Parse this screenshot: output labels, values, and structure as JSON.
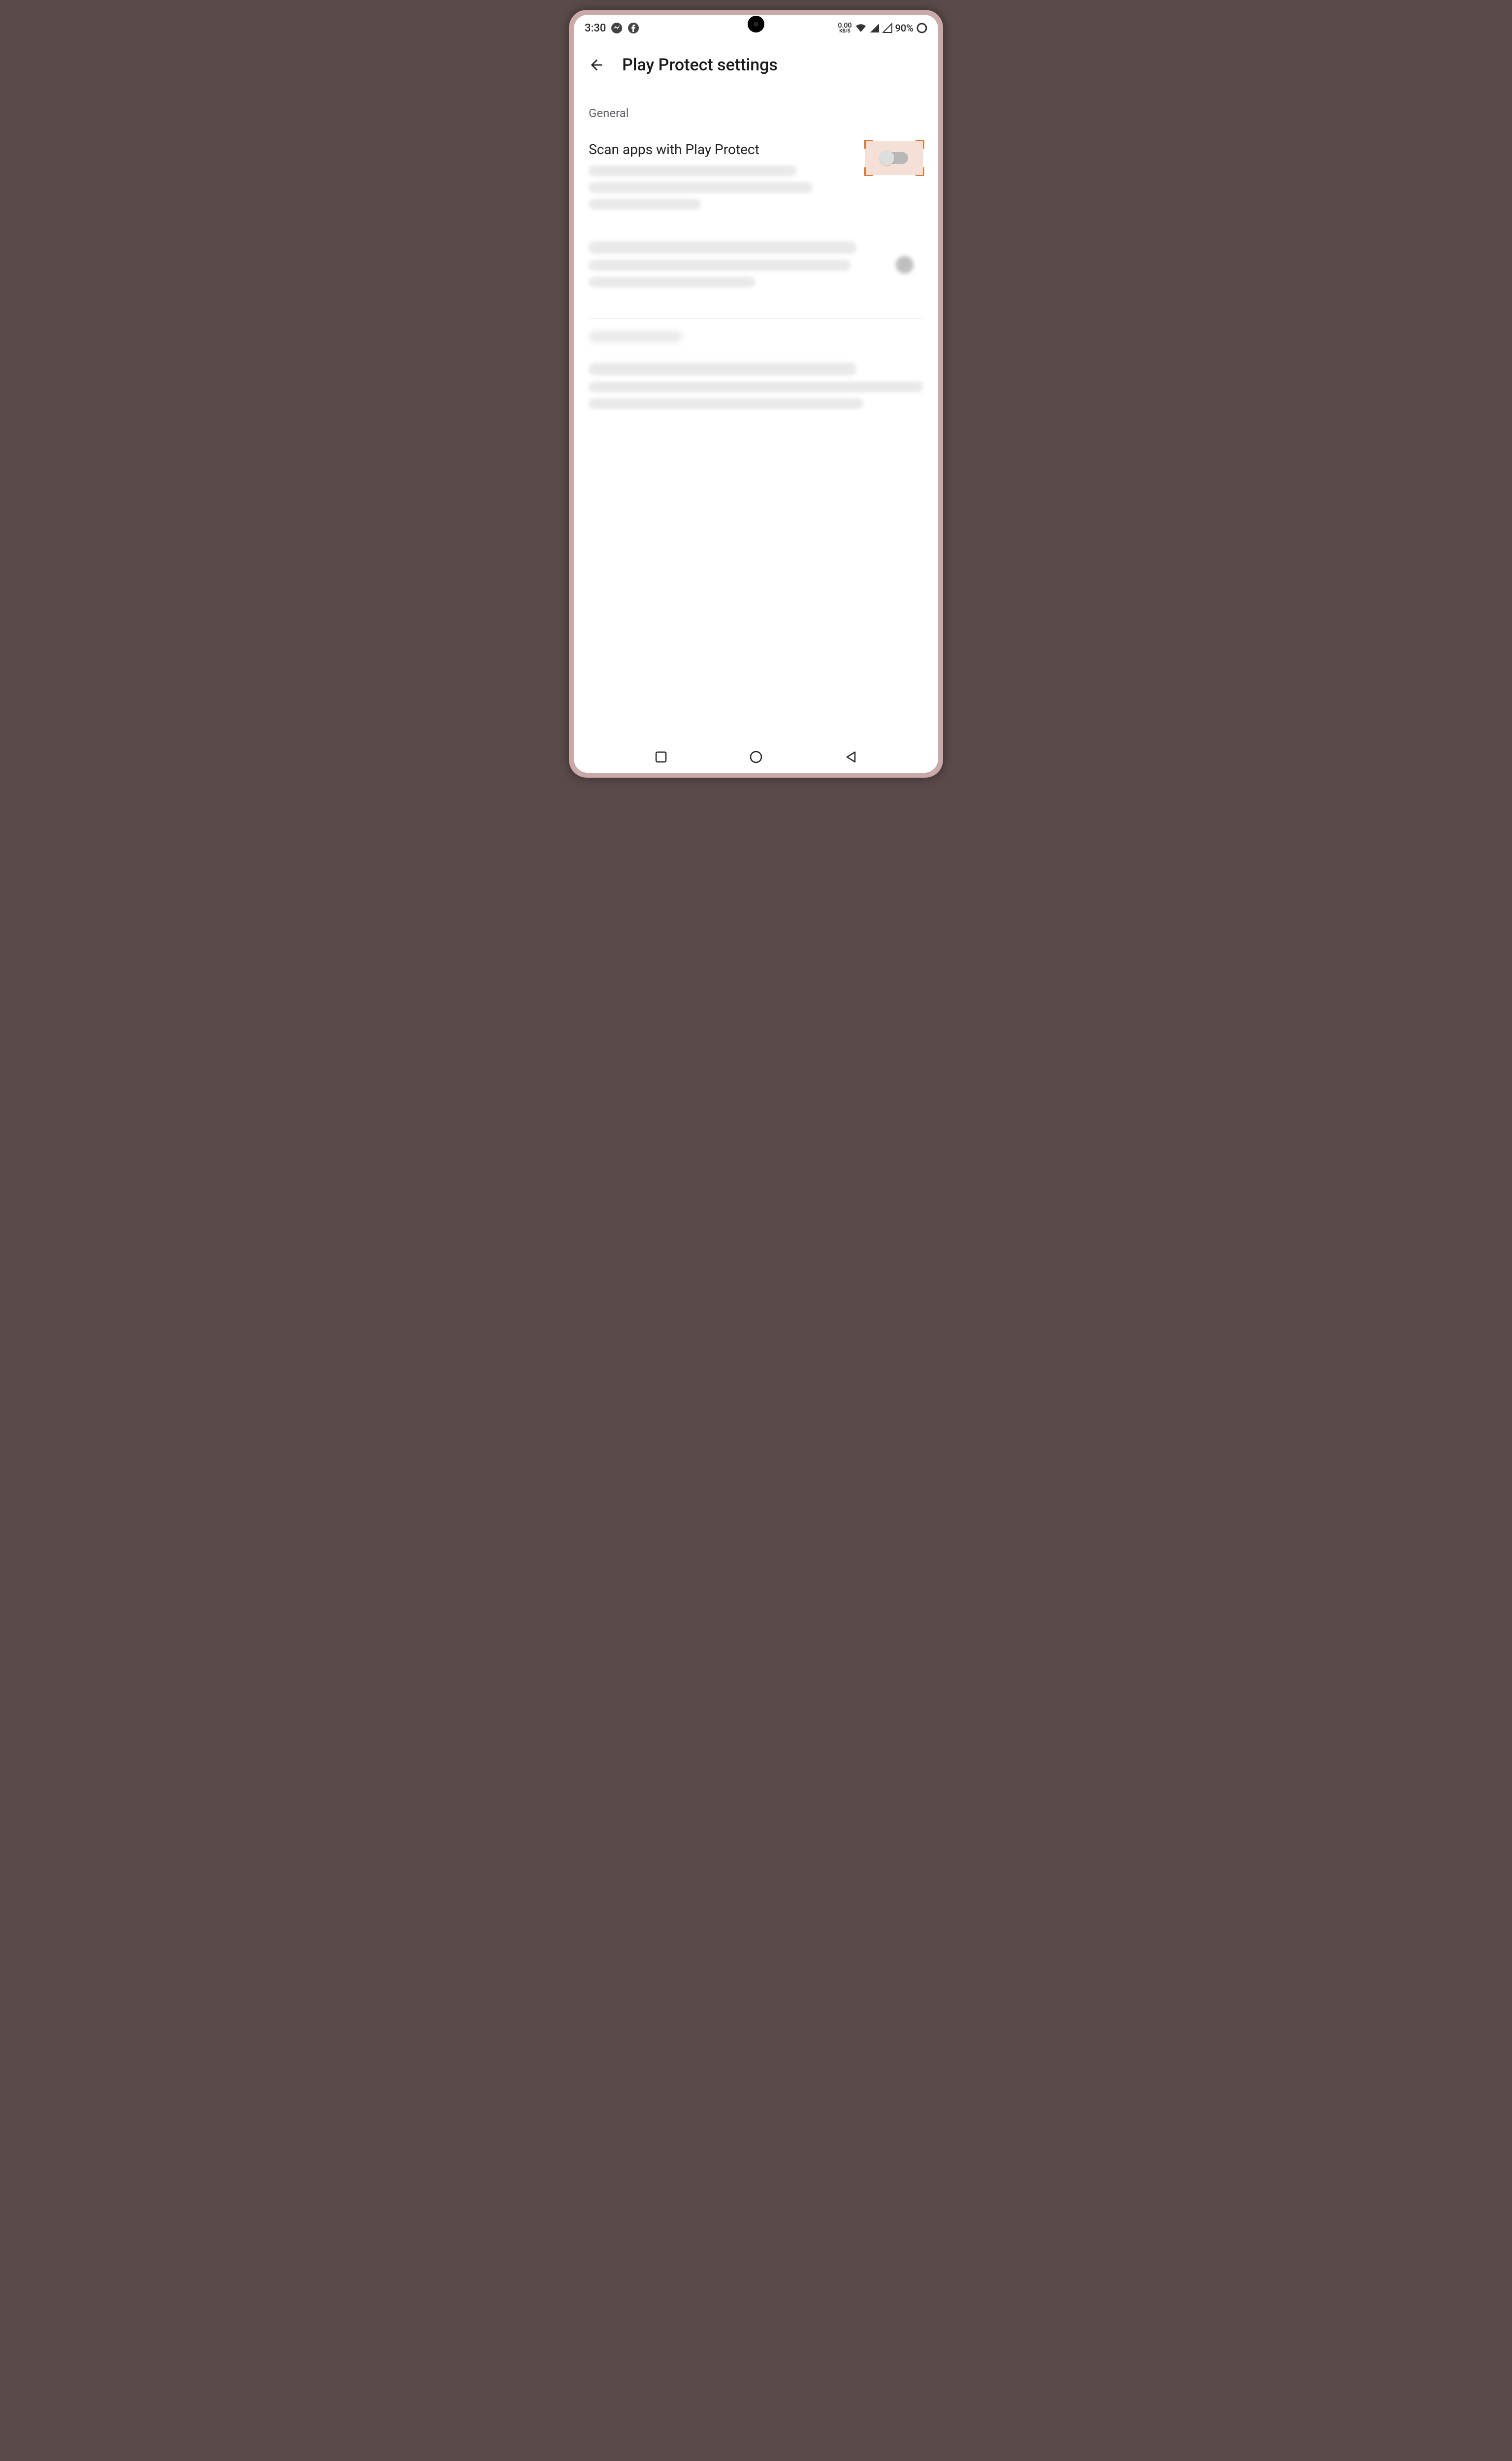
{
  "status": {
    "time": "3:30",
    "data_rate_value": "0.00",
    "data_rate_unit": "KB/S",
    "battery_pct": "90%",
    "icons_left": [
      "messenger",
      "facebook"
    ],
    "icons_right": [
      "wifi",
      "signal1",
      "signal2",
      "data-saver"
    ]
  },
  "header": {
    "title": "Play Protect settings"
  },
  "sections": {
    "general_label": "General",
    "scan_apps": {
      "title": "Scan apps with Play Protect",
      "toggle_state": "off",
      "highlighted": true
    }
  },
  "colors": {
    "highlight_bg": "#f5e0d8",
    "highlight_border": "#d97a3a",
    "text_primary": "#202124",
    "text_secondary": "#5f6368"
  }
}
